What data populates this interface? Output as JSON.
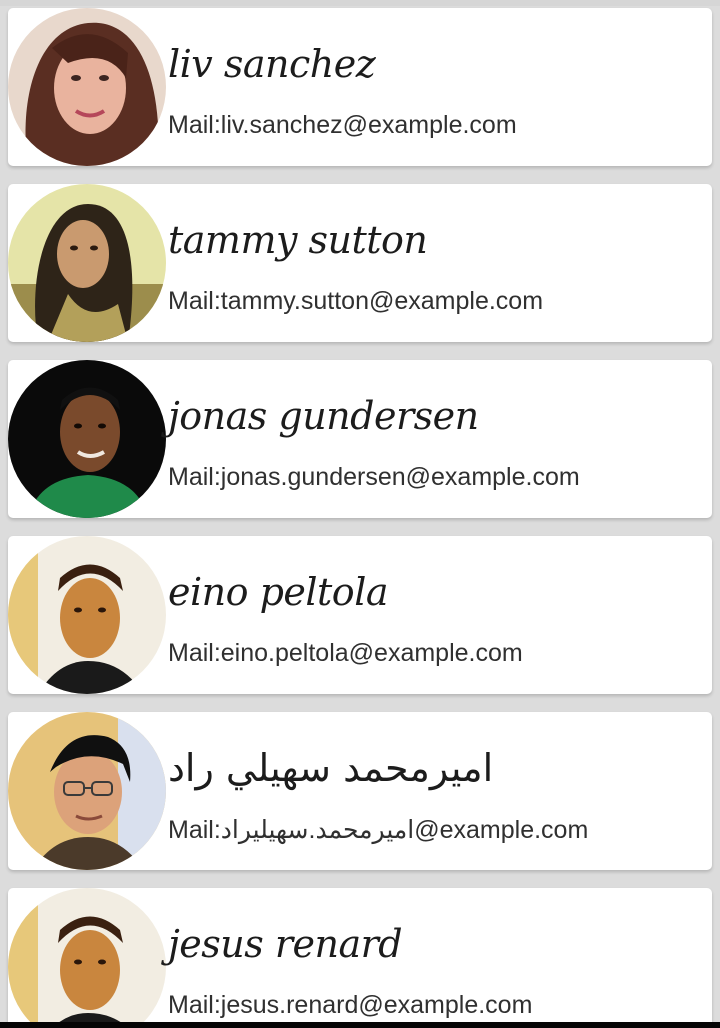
{
  "contacts": [
    {
      "name": "liv sanchez",
      "email": "Mail:liv.sanchez@example.com"
    },
    {
      "name": "tammy sutton",
      "email": "Mail:tammy.sutton@example.com"
    },
    {
      "name": "jonas gundersen",
      "email": "Mail:jonas.gundersen@example.com"
    },
    {
      "name": "eino peltola",
      "email": "Mail:eino.peltola@example.com"
    },
    {
      "name": "اميرمحمد سهيلي راد",
      "email": "Mail:اميرمحمد.سهيليراد@example.com"
    },
    {
      "name": "jesus renard",
      "email": "Mail:jesus.renard@example.com"
    }
  ],
  "colors": {
    "background": "#dcdcdc",
    "card": "#ffffff",
    "name_text": "#1c1c1c",
    "email_text": "#303030"
  }
}
